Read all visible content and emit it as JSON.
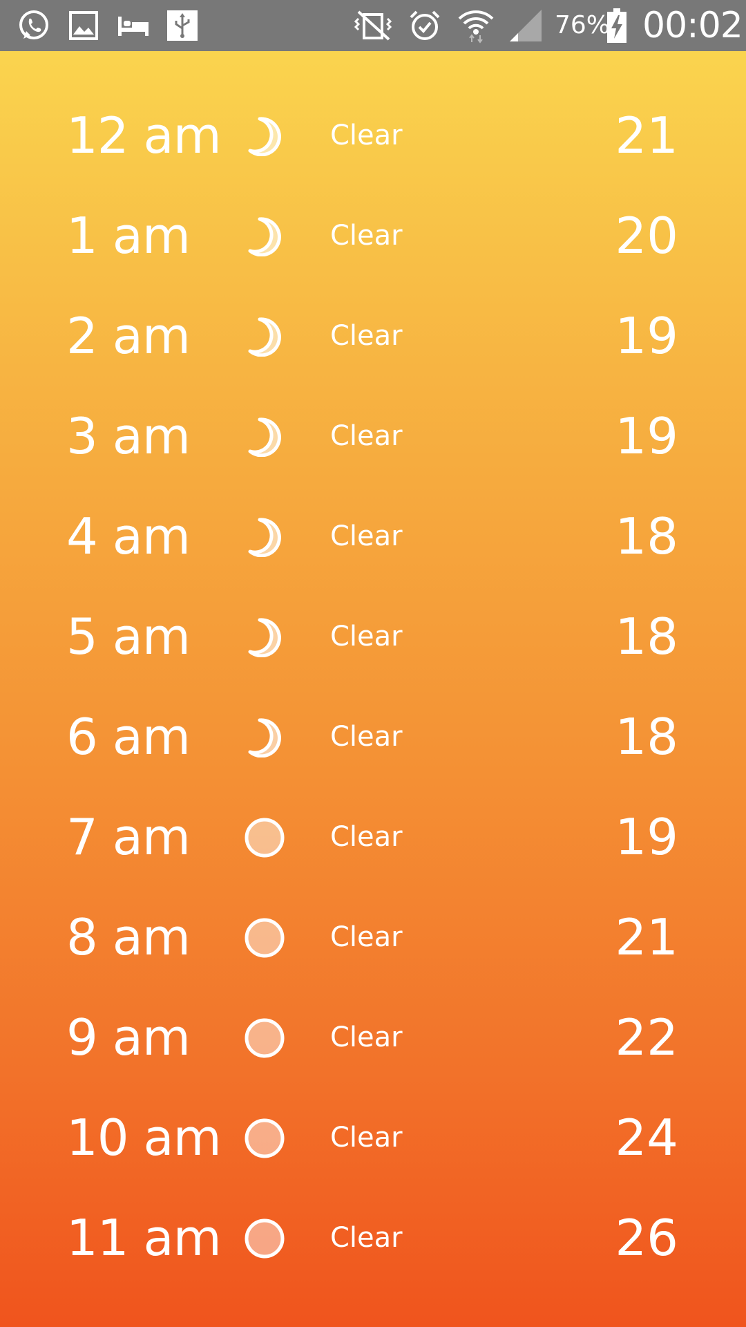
{
  "status_bar": {
    "icons": [
      "whatsapp-icon",
      "gallery-icon",
      "bed-icon",
      "usb-icon",
      "vibrate-off-icon",
      "alarm-icon",
      "wifi-icon",
      "signal-icon",
      "battery-charging-icon"
    ],
    "battery_percent": "76%",
    "time": "00:02"
  },
  "forecast": {
    "rows": [
      {
        "time": "12 am",
        "icon": "moon-icon",
        "condition": "Clear",
        "temp": "21"
      },
      {
        "time": "1 am",
        "icon": "moon-icon",
        "condition": "Clear",
        "temp": "20"
      },
      {
        "time": "2 am",
        "icon": "moon-icon",
        "condition": "Clear",
        "temp": "19"
      },
      {
        "time": "3 am",
        "icon": "moon-icon",
        "condition": "Clear",
        "temp": "19"
      },
      {
        "time": "4 am",
        "icon": "moon-icon",
        "condition": "Clear",
        "temp": "18"
      },
      {
        "time": "5 am",
        "icon": "moon-icon",
        "condition": "Clear",
        "temp": "18"
      },
      {
        "time": "6 am",
        "icon": "moon-icon",
        "condition": "Clear",
        "temp": "18"
      },
      {
        "time": "7 am",
        "icon": "sun-icon",
        "condition": "Clear",
        "temp": "19"
      },
      {
        "time": "8 am",
        "icon": "sun-icon",
        "condition": "Clear",
        "temp": "21"
      },
      {
        "time": "9 am",
        "icon": "sun-icon",
        "condition": "Clear",
        "temp": "22"
      },
      {
        "time": "10 am",
        "icon": "sun-icon",
        "condition": "Clear",
        "temp": "24"
      },
      {
        "time": "11 am",
        "icon": "sun-icon",
        "condition": "Clear",
        "temp": "26"
      }
    ]
  },
  "colors": {
    "gradient_top": "#fad44e",
    "gradient_bottom": "#f0541d",
    "status_bar": "#787878",
    "text": "#ffffff"
  }
}
